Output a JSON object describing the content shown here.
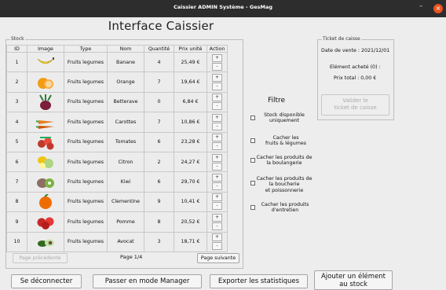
{
  "window": {
    "title": "Caissier ADMIN Système - GesMag",
    "minimize": "–",
    "close": "×"
  },
  "app_title": "Interface Caissier",
  "stock": {
    "label": "Stock",
    "columns": [
      "ID",
      "Image",
      "Type",
      "Nom",
      "Quantité",
      "Prix unité",
      "Action"
    ],
    "rows": [
      {
        "id": "1",
        "type": "Fruits legumes",
        "nom": "Banane",
        "qte": "4",
        "prix": "25,49 €",
        "img": "banana"
      },
      {
        "id": "2",
        "type": "Fruits legumes",
        "nom": "Orange",
        "qte": "7",
        "prix": "19,64 €",
        "img": "orange"
      },
      {
        "id": "3",
        "type": "Fruits legumes",
        "nom": "Betterave",
        "qte": "0",
        "prix": "6,84 €",
        "img": "beet"
      },
      {
        "id": "4",
        "type": "Fruits legumes",
        "nom": "Carottes",
        "qte": "7",
        "prix": "10,86 €",
        "img": "carrot"
      },
      {
        "id": "5",
        "type": "Fruits legumes",
        "nom": "Tomates",
        "qte": "6",
        "prix": "23,28 €",
        "img": "tomato"
      },
      {
        "id": "6",
        "type": "Fruits legumes",
        "nom": "Citron",
        "qte": "2",
        "prix": "24,27 €",
        "img": "lemon"
      },
      {
        "id": "7",
        "type": "Fruits legumes",
        "nom": "Kiwi",
        "qte": "6",
        "prix": "29,70 €",
        "img": "kiwi"
      },
      {
        "id": "8",
        "type": "Fruits legumes",
        "nom": "Clementine",
        "qte": "9",
        "prix": "10,41 €",
        "img": "clementine"
      },
      {
        "id": "9",
        "type": "Fruits legumes",
        "nom": "Pomme",
        "qte": "8",
        "prix": "20,52 €",
        "img": "apple"
      },
      {
        "id": "10",
        "type": "Fruits legumes",
        "nom": "Avocat",
        "qte": "3",
        "prix": "18,71 €",
        "img": "avocado"
      }
    ],
    "plus": "+",
    "minus": "-"
  },
  "pagination": {
    "prev": "Page précédente",
    "label": "Page 1/4",
    "next": "Page suivante"
  },
  "filter": {
    "title": "Filtre",
    "options": [
      [
        "Stock disponible",
        "uniquement"
      ],
      [
        "Cacher les",
        "fruits & légumes"
      ],
      [
        "Cacher les produits de",
        "la boulangerie"
      ],
      [
        "Cacher les produits de",
        "la boucherie",
        "et poissonnerie"
      ],
      [
        "Cacher les produits",
        "d'entretien"
      ]
    ]
  },
  "ticket": {
    "label": "Ticket de caisse",
    "date": "Date de vente : 2021/12/01",
    "items": "Elément acheté (0) :",
    "total": "Prix total : 0,00 €",
    "validate": [
      "Valider le",
      "ticket de caisse"
    ]
  },
  "bottom": {
    "logout": "Se déconnecter",
    "manager": "Passer en mode Manager",
    "export": "Exporter les statistiques",
    "add": [
      "Ajouter un élément",
      "au stock"
    ]
  }
}
